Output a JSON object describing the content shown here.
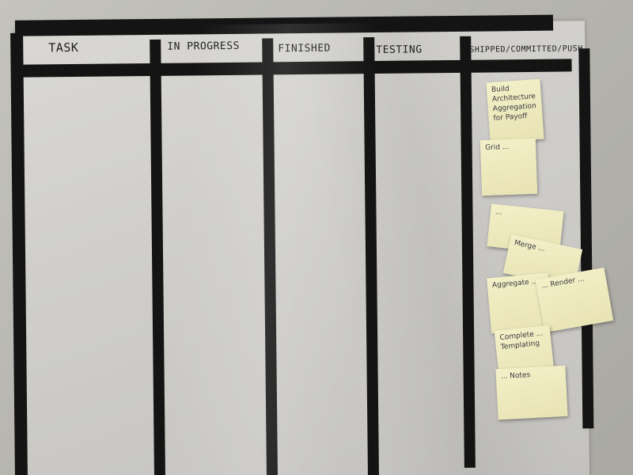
{
  "board": {
    "columns": [
      {
        "label": "TASK"
      },
      {
        "label": "IN PROGRESS"
      },
      {
        "label": "FINISHED"
      },
      {
        "label": "TESTING"
      },
      {
        "label": "SHIPPED/COMMITTED/PUSH"
      }
    ]
  },
  "notes": [
    {
      "text": "Build Architecture Aggregation for Payoff"
    },
    {
      "text": "Grid ..."
    },
    {
      "text": "..."
    },
    {
      "text": "Merge ..."
    },
    {
      "text": "Aggregate ..."
    },
    {
      "text": "... Render ..."
    },
    {
      "text": "Complete ... Templating"
    },
    {
      "text": "... Notes"
    }
  ]
}
